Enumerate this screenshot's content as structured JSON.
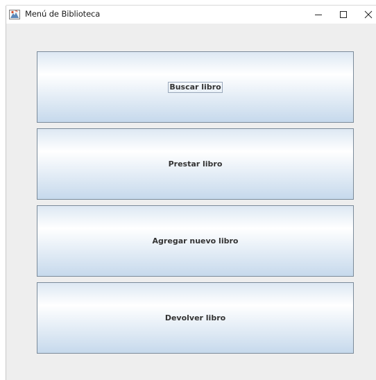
{
  "window": {
    "title": "Menú de Biblioteca",
    "app_icon": "java-duke-icon"
  },
  "title_controls": {
    "minimize_icon": "minimize-icon",
    "maximize_icon": "maximize-icon",
    "close_icon": "close-icon"
  },
  "menu": {
    "buttons": [
      {
        "label": "Buscar libro",
        "focused": true
      },
      {
        "label": "Prestar libro",
        "focused": false
      },
      {
        "label": "Agregar nuevo libro",
        "focused": false
      },
      {
        "label": "Devolver libro",
        "focused": false
      }
    ]
  },
  "colors": {
    "button_border": "#7a8a99",
    "button_gradient_top": "#dde8f3",
    "button_gradient_mid": "#ffffff",
    "button_gradient_bottom": "#c6d9ec",
    "panel_background": "#eeeeee",
    "button_text": "#333333"
  }
}
